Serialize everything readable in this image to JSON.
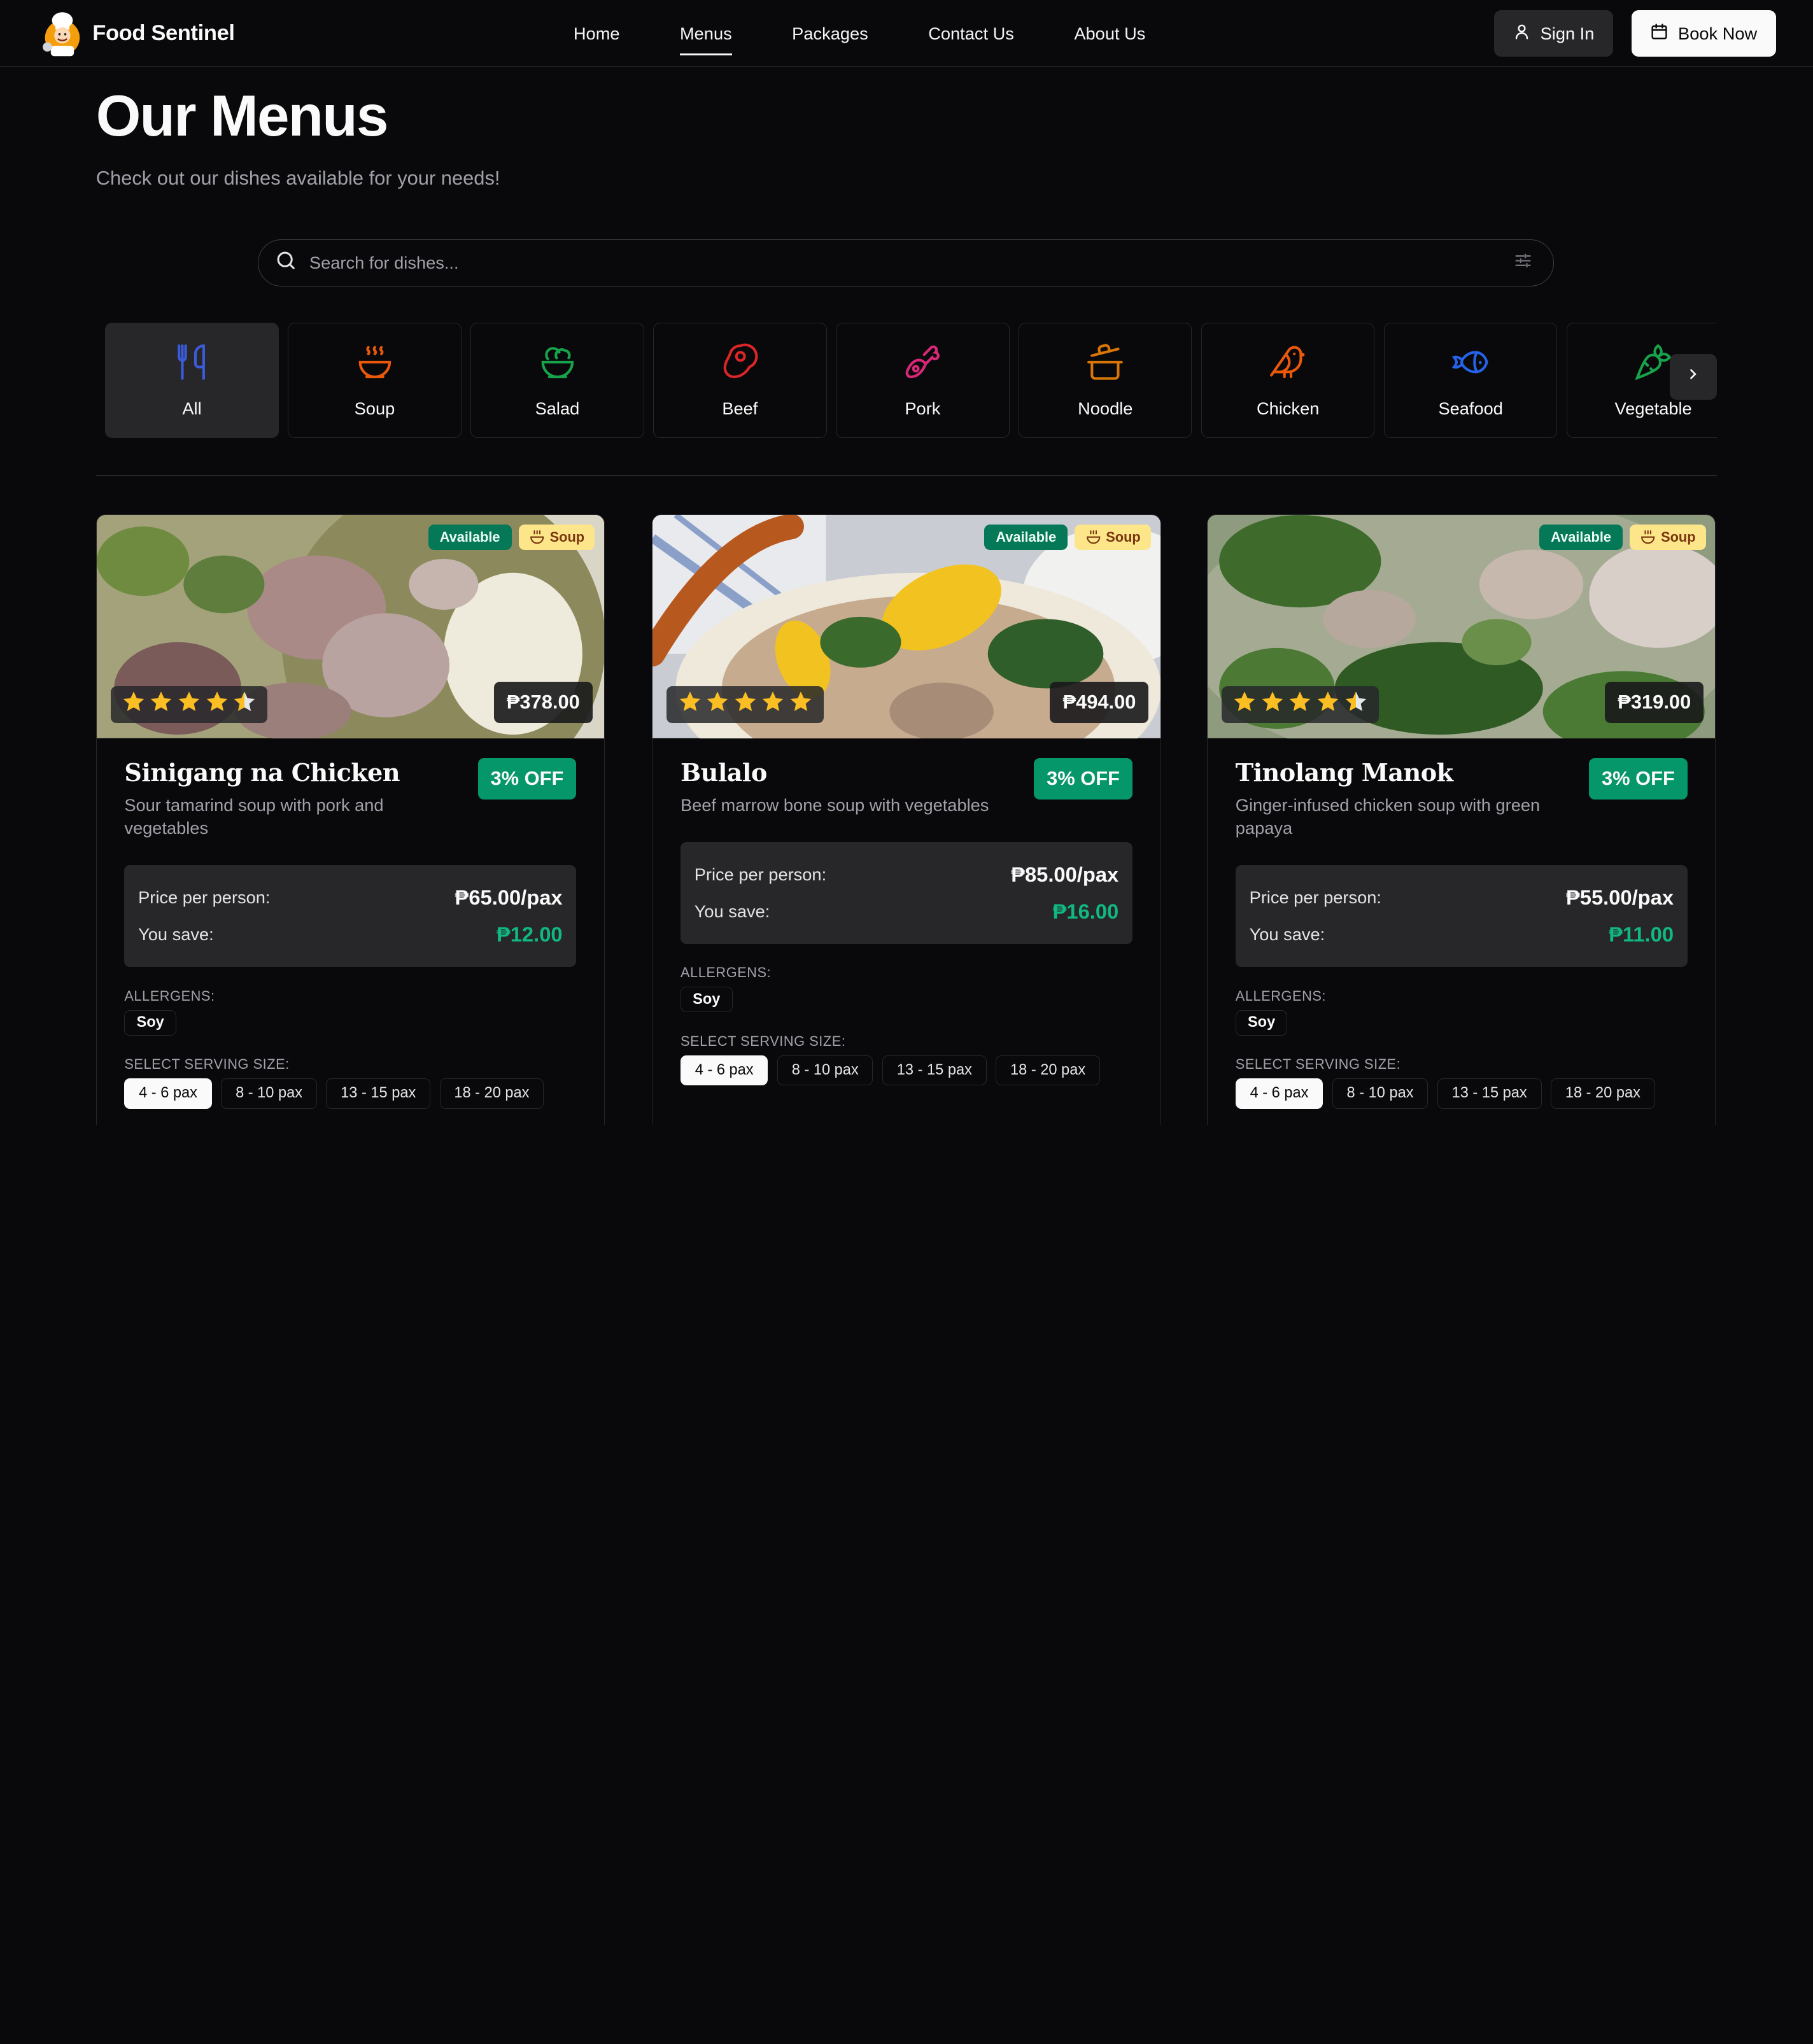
{
  "nav": {
    "brand": "Food Sentinel",
    "links": [
      "Home",
      "Menus",
      "Packages",
      "Contact Us",
      "About Us"
    ],
    "active": "Menus",
    "signin": "Sign In",
    "book": "Book Now"
  },
  "header": {
    "title": "Our Menus",
    "subtitle": "Check out our dishes available for your needs!"
  },
  "search": {
    "placeholder": "Search for dishes..."
  },
  "categories": [
    {
      "label": "All",
      "icon": "utensils-icon",
      "color": "#3b5bdb"
    },
    {
      "label": "Soup",
      "icon": "soup-bowl-icon",
      "color": "#ea580c"
    },
    {
      "label": "Salad",
      "icon": "salad-icon",
      "color": "#16a34a"
    },
    {
      "label": "Beef",
      "icon": "beef-icon",
      "color": "#dc2626"
    },
    {
      "label": "Pork",
      "icon": "ham-icon",
      "color": "#db2777"
    },
    {
      "label": "Noodle",
      "icon": "cooking-pot-icon",
      "color": "#d97706"
    },
    {
      "label": "Chicken",
      "icon": "bird-icon",
      "color": "#ea580c"
    },
    {
      "label": "Seafood",
      "icon": "fish-icon",
      "color": "#2563eb"
    },
    {
      "label": "Vegetable",
      "icon": "carrot-icon",
      "color": "#16a34a"
    }
  ],
  "cards": [
    {
      "available": "Available",
      "category": "Soup",
      "rating": 4.5,
      "price": "₱378.00",
      "title": "Sinigang na Chicken",
      "discount": "3% OFF",
      "description": "Sour tamarind soup with pork and vegetables",
      "price_label": "Price per person:",
      "per_person": "₱65.00/pax",
      "save_label": "You save:",
      "save": "₱12.00",
      "allergens_label": "ALLERGENS:",
      "allergens": [
        "Soy"
      ],
      "sizes_label": "SELECT SERVING SIZE:",
      "sizes": [
        "4 - 6 pax",
        "8 - 10 pax",
        "13 - 15 pax",
        "18 - 20 pax"
      ],
      "selected_size": "4 - 6 pax"
    },
    {
      "available": "Available",
      "category": "Soup",
      "rating": 5,
      "price": "₱494.00",
      "title": "Bulalo",
      "discount": "3% OFF",
      "description": "Beef marrow bone soup with vegetables",
      "price_label": "Price per person:",
      "per_person": "₱85.00/pax",
      "save_label": "You save:",
      "save": "₱16.00",
      "allergens_label": "ALLERGENS:",
      "allergens": [
        "Soy"
      ],
      "sizes_label": "SELECT SERVING SIZE:",
      "sizes": [
        "4 - 6 pax",
        "8 - 10 pax",
        "13 - 15 pax",
        "18 - 20 pax"
      ],
      "selected_size": "4 - 6 pax"
    },
    {
      "available": "Available",
      "category": "Soup",
      "rating": 4.5,
      "price": "₱319.00",
      "title": "Tinolang Manok",
      "discount": "3% OFF",
      "description": "Ginger-infused chicken soup with green papaya",
      "price_label": "Price per person:",
      "per_person": "₱55.00/pax",
      "save_label": "You save:",
      "save": "₱11.00",
      "allergens_label": "ALLERGENS:",
      "allergens": [
        "Soy"
      ],
      "sizes_label": "SELECT SERVING SIZE:",
      "sizes": [
        "4 - 6 pax",
        "8 - 10 pax",
        "13 - 15 pax",
        "18 - 20 pax"
      ],
      "selected_size": "4 - 6 pax"
    }
  ],
  "colors": {
    "background": "#09090b",
    "available": "#047857",
    "discount": "#059669",
    "savings": "#10b981",
    "star": "#fbbf24",
    "soup_badge": "#fde68a"
  }
}
